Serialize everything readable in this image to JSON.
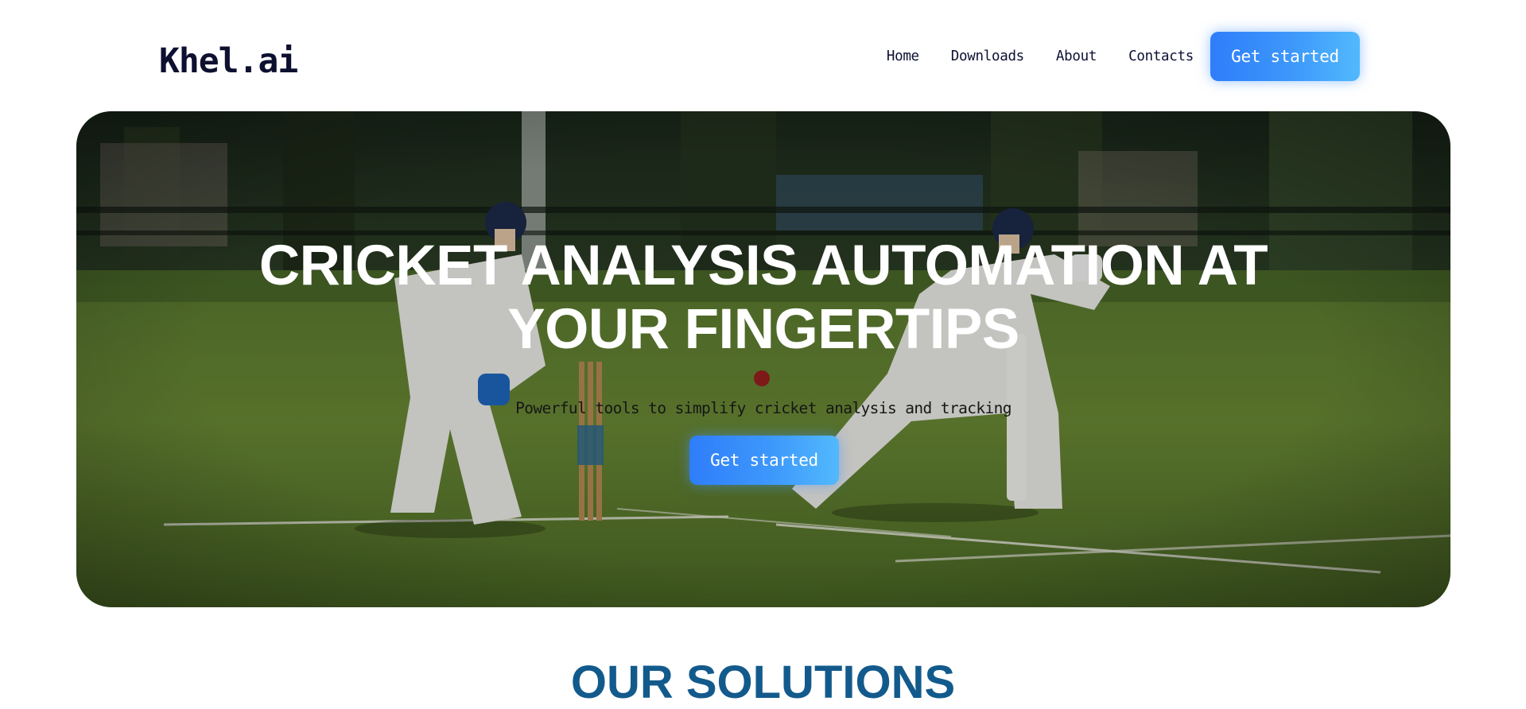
{
  "header": {
    "logo": "Khel.ai",
    "nav": [
      {
        "label": "Home"
      },
      {
        "label": "Downloads"
      },
      {
        "label": "About"
      },
      {
        "label": "Contacts"
      }
    ],
    "cta_label": "Get started"
  },
  "hero": {
    "title_line1": "CRICKET ANALYSIS AUTOMATION AT",
    "title_line2": "YOUR FINGERTIPS",
    "subtitle": "Powerful tools to simplify cricket analysis and tracking",
    "cta_label": "Get started",
    "image": "cricket-match-photo"
  },
  "solutions": {
    "title": "OUR SOLUTIONS"
  },
  "colors": {
    "brand_text": "#0e1030",
    "button_gradient_start": "#2f7dfa",
    "button_gradient_end": "#52b9fd",
    "section_title": "#135a8c"
  }
}
